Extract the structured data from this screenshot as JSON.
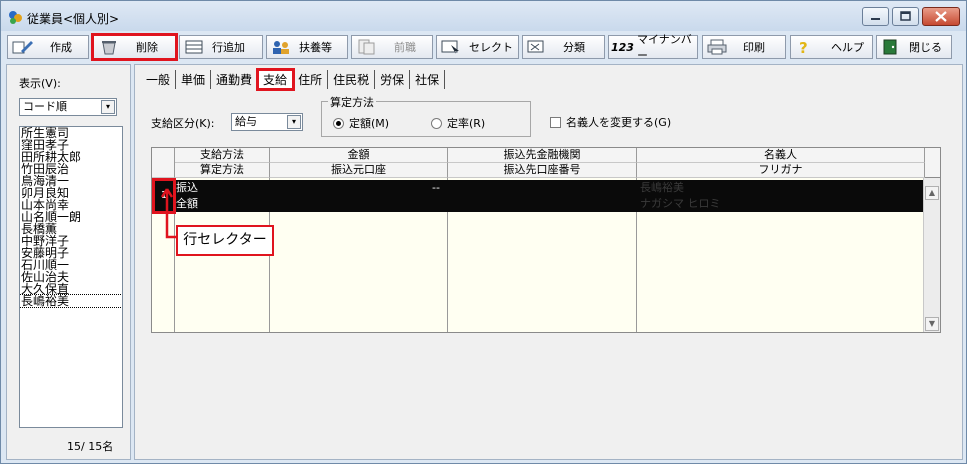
{
  "window": {
    "title": "従業員<個人別>"
  },
  "toolbar": {
    "create_label": "作成",
    "delete_label": "削除",
    "add_row_label": "行追加",
    "dependents_label": "扶養等",
    "prev_job_label": "前職",
    "select_label": "セレクト",
    "split_label": "分類",
    "mynumber_prefix": "123",
    "mynumber_label": "マイナンバー",
    "print_label": "印刷",
    "help_label": "ヘルプ",
    "close_label": "閉じる"
  },
  "left_panel": {
    "display_label": "表示(V):",
    "sort_value": "コード順",
    "employees": [
      "所生憲司",
      "窪田孝子",
      "田所耕太郎",
      "竹田辰治",
      "鳥海清一",
      "卯月良知",
      "山本尚幸",
      "山名順一朗",
      "長橋薫",
      "中野洋子",
      "安藤明子",
      "石川順一",
      "佐山治夫",
      "大久保直",
      "長嶋裕美"
    ],
    "count_text": "15/ 15名"
  },
  "tabs": [
    "一般",
    "単価",
    "通勤費",
    "支給",
    "住所",
    "住民税",
    "労保",
    "社保"
  ],
  "form": {
    "pay_category_label": "支給区分(K):",
    "pay_category_value": "給与",
    "calc_method_title": "算定方法",
    "fixed_amount_label": "定額(M)",
    "fixed_rate_label": "定率(R)",
    "change_holder_label": "名義人を変更する(G)"
  },
  "grid": {
    "headers_top": [
      "支給方法",
      "金額",
      "振込先金融機関",
      "名義人"
    ],
    "headers_bottom": [
      "算定方法",
      "振込元口座",
      "振込先口座番号",
      "フリガナ"
    ],
    "row_number": "1",
    "row1": {
      "method": "振込",
      "amount": "--",
      "holder": "長嶋裕美"
    },
    "row2": {
      "calc": "全額",
      "furigana": "ナガシマ ヒロミ"
    }
  },
  "annotation": {
    "callout_text": "行セレクター"
  }
}
